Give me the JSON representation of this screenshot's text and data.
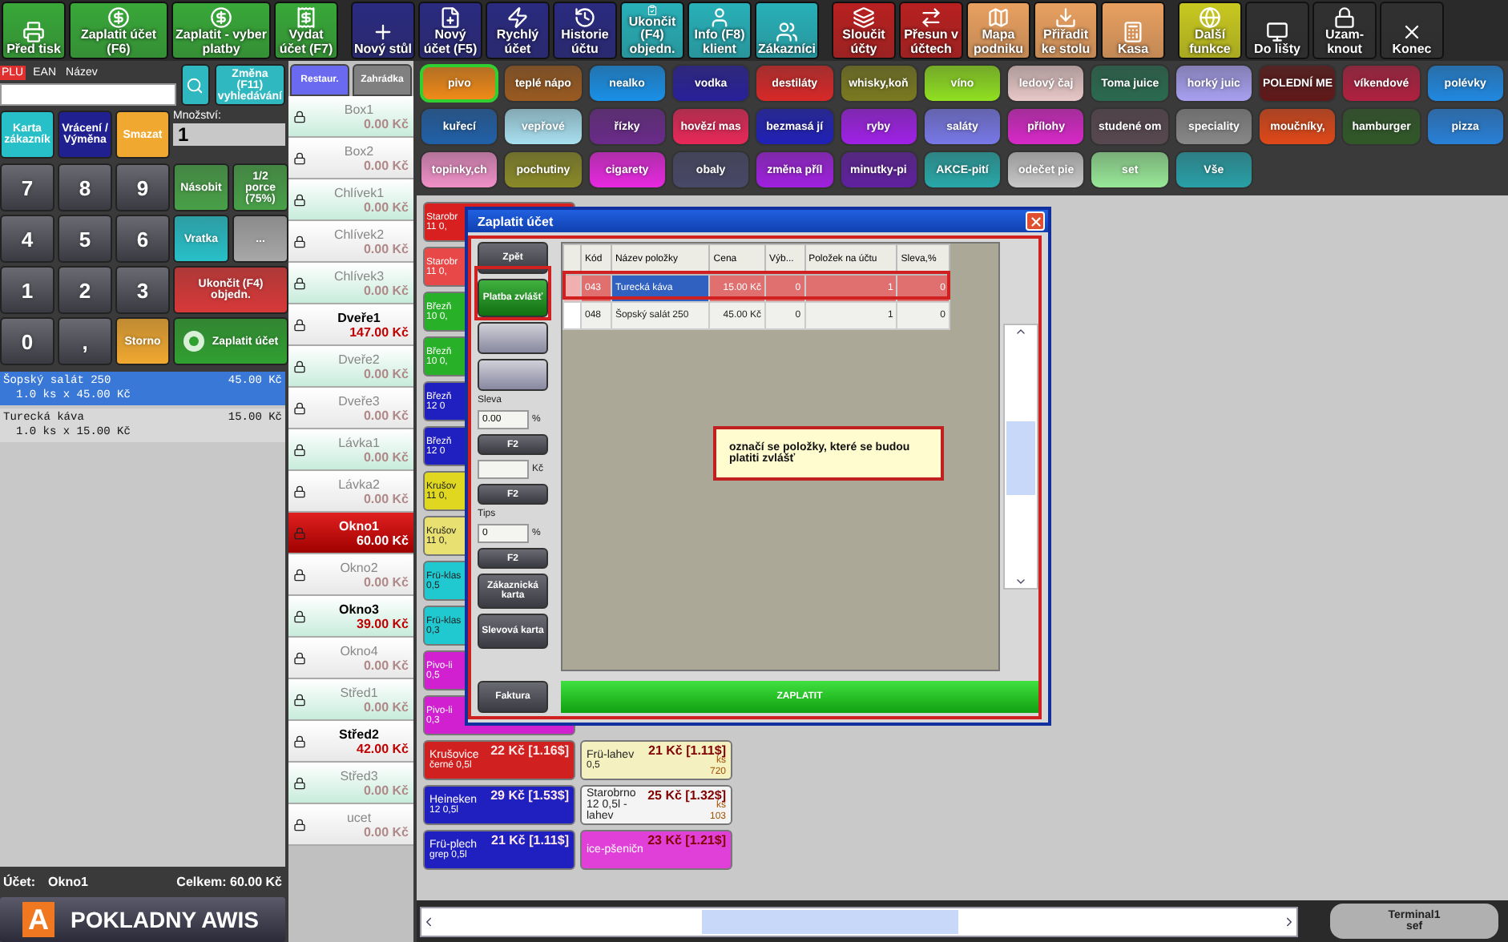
{
  "toolbar": [
    {
      "label": "Před tisk",
      "color": "#38a838",
      "kind": "normal"
    },
    {
      "label": "Zaplatit účet (F6)",
      "color": "#38a838",
      "kind": "wide"
    },
    {
      "label": "Zaplatit - vyber platby",
      "color": "#38a838",
      "kind": "wide"
    },
    {
      "label": "Vydat účet (F7)",
      "color": "#38a838",
      "kind": "normal"
    },
    {
      "label": "Nový stůl",
      "color": "#2a2a80",
      "kind": "normal"
    },
    {
      "label": "Nový účet (F5)",
      "color": "#2a2a80",
      "kind": "normal"
    },
    {
      "label": "Rychlý účet",
      "color": "#2a2a80",
      "kind": "normal"
    },
    {
      "label": "Historie účtu",
      "color": "#2a2a80",
      "kind": "normal"
    },
    {
      "label": "Ukončit (F4) objedn.",
      "color": "#28b0b8",
      "kind": "normal"
    },
    {
      "label": "Info (F8) klient",
      "color": "#28b0b8",
      "kind": "normal"
    },
    {
      "label": "Zákazníci",
      "color": "#28b0b8",
      "kind": "normal"
    },
    {
      "label": "Sloučit účty",
      "color": "#b82020",
      "kind": "normal"
    },
    {
      "label": "Přesun v účtech",
      "color": "#b82020",
      "kind": "normal"
    },
    {
      "label": "Mapa podniku",
      "color": "#e8a060",
      "kind": "normal"
    },
    {
      "label": "Přiřadit ke stolu",
      "color": "#e8a060",
      "kind": "normal"
    },
    {
      "label": "Kasa",
      "color": "#e8a060",
      "kind": "normal"
    },
    {
      "label": "Další funkce",
      "color": "#c8c820",
      "kind": "normal"
    },
    {
      "label": "Do lišty",
      "color": "#303030",
      "kind": "normal"
    },
    {
      "label": "Uzam-knout",
      "color": "#303030",
      "kind": "normal"
    },
    {
      "label": "Konec",
      "color": "#303030",
      "kind": "normal"
    }
  ],
  "search": {
    "modes": [
      {
        "label": "PLU",
        "selected": true
      },
      {
        "label": "EAN",
        "selected": false
      },
      {
        "label": "Název",
        "selected": false
      }
    ],
    "change_button": "Změna (F11) vyhledávání"
  },
  "quick_buttons": [
    {
      "label": "Karta zákazník",
      "color": "#28c0c8"
    },
    {
      "label": "Vrácení / Výměna",
      "color": "#202090"
    },
    {
      "label": "Smazat",
      "color": "#f0a830"
    }
  ],
  "quantity": {
    "label": "Množství:",
    "value": "1"
  },
  "keypad": [
    {
      "label": "7",
      "kind": "key"
    },
    {
      "label": "8",
      "kind": "key"
    },
    {
      "label": "9",
      "kind": "key"
    },
    {
      "label": "Násobit",
      "kind": "action",
      "color": "#48a048"
    },
    {
      "label": "1/2 porce (75%)",
      "kind": "action",
      "color": "#48a048"
    },
    {
      "label": "4",
      "kind": "key"
    },
    {
      "label": "5",
      "kind": "key"
    },
    {
      "label": "6",
      "kind": "key"
    },
    {
      "label": "Vratka",
      "kind": "action",
      "color": "#28c0c8"
    },
    {
      "label": "...",
      "kind": "action",
      "color": "#a8a8a8"
    },
    {
      "label": "1",
      "kind": "key"
    },
    {
      "label": "2",
      "kind": "key"
    },
    {
      "label": "3",
      "kind": "key"
    },
    {
      "label": "Ukončit (F4) objedn.",
      "kind": "wide",
      "color": "#d83838"
    },
    {
      "label": "0",
      "kind": "key"
    },
    {
      "label": ",",
      "kind": "key"
    },
    {
      "label": "Storno",
      "kind": "action",
      "color": "#f0a830"
    },
    {
      "label": "Zaplatit účet",
      "kind": "pay",
      "color": "#30a030"
    }
  ],
  "order": {
    "items": [
      {
        "name": "Šopský salát 250",
        "detail": "1.0 ks x 45.00 Kč",
        "price": "45.00 Kč",
        "selected": true
      },
      {
        "name": "Turecká káva",
        "detail": "1.0 ks x 15.00 Kč",
        "price": "15.00 Kč",
        "selected": false
      }
    ],
    "account_label": "Účet:",
    "account": "Okno1",
    "total": "Celkem: 60.00 Kč"
  },
  "logo": {
    "mark": "A",
    "text": "POKLADNY AWIS"
  },
  "areas": [
    {
      "label": "Restaur.",
      "selected": true
    },
    {
      "label": "Zahrádka",
      "selected": false
    }
  ],
  "tables": [
    {
      "name": "Box1",
      "amount": "0.00 Kč",
      "occupied": false,
      "selected": false
    },
    {
      "name": "Box2",
      "amount": "0.00 Kč",
      "occupied": false,
      "selected": false
    },
    {
      "name": "Chlívek1",
      "amount": "0.00 Kč",
      "occupied": false,
      "selected": false
    },
    {
      "name": "Chlívek2",
      "amount": "0.00 Kč",
      "occupied": false,
      "selected": false
    },
    {
      "name": "Chlívek3",
      "amount": "0.00 Kč",
      "occupied": false,
      "selected": false
    },
    {
      "name": "Dveře1",
      "amount": "147.00 Kč",
      "occupied": true,
      "selected": false
    },
    {
      "name": "Dveře2",
      "amount": "0.00 Kč",
      "occupied": false,
      "selected": false
    },
    {
      "name": "Dveře3",
      "amount": "0.00 Kč",
      "occupied": false,
      "selected": false
    },
    {
      "name": "Lávka1",
      "amount": "0.00 Kč",
      "occupied": false,
      "selected": false
    },
    {
      "name": "Lávka2",
      "amount": "0.00 Kč",
      "occupied": false,
      "selected": false
    },
    {
      "name": "Okno1",
      "amount": "60.00 Kč",
      "occupied": true,
      "selected": true
    },
    {
      "name": "Okno2",
      "amount": "0.00 Kč",
      "occupied": false,
      "selected": false
    },
    {
      "name": "Okno3",
      "amount": "39.00 Kč",
      "occupied": true,
      "selected": false
    },
    {
      "name": "Okno4",
      "amount": "0.00 Kč",
      "occupied": false,
      "selected": false
    },
    {
      "name": "Střed1",
      "amount": "0.00 Kč",
      "occupied": false,
      "selected": false
    },
    {
      "name": "Střed2",
      "amount": "42.00 Kč",
      "occupied": true,
      "selected": false
    },
    {
      "name": "Střed3",
      "amount": "0.00 Kč",
      "occupied": false,
      "selected": false
    },
    {
      "name": "ucet",
      "amount": "0.00 Kč",
      "occupied": false,
      "selected": false
    }
  ],
  "categories": [
    {
      "label": "pivo",
      "color": "#f08a18",
      "selected": true
    },
    {
      "label": "teplé nápo",
      "color": "#9a5a20",
      "selected": false
    },
    {
      "label": "nealko",
      "color": "#1890e8",
      "selected": false
    },
    {
      "label": "vodka",
      "color": "#28209a",
      "selected": false
    },
    {
      "label": "destiláty",
      "color": "#d82828",
      "selected": false
    },
    {
      "label": "whisky,koň",
      "color": "#7a7a20",
      "selected": false
    },
    {
      "label": "víno",
      "color": "#90e020",
      "selected": false
    },
    {
      "label": "ledový čaj",
      "color": "#e8c8c8",
      "selected": false
    },
    {
      "label": "Toma juice",
      "color": "#2a6a50",
      "selected": false
    },
    {
      "label": "horký juic",
      "color": "#a8a0f0",
      "selected": false
    },
    {
      "label": "POLEDNÍ ME",
      "color": "#601818",
      "selected": false
    },
    {
      "label": "víkendové",
      "color": "#b02040",
      "selected": false
    },
    {
      "label": "polévky",
      "color": "#2088e0",
      "selected": false
    },
    {
      "label": "kuřecí",
      "color": "#2060a8",
      "selected": false
    },
    {
      "label": "vepřové",
      "color": "#a8e0f0",
      "selected": false
    },
    {
      "label": "řízky",
      "color": "#6a2a8a",
      "selected": false
    },
    {
      "label": "hovězí mas",
      "color": "#e82858",
      "selected": false
    },
    {
      "label": "bezmasá jí",
      "color": "#2020b8",
      "selected": false
    },
    {
      "label": "ryby",
      "color": "#a020e8",
      "selected": false
    },
    {
      "label": "saláty",
      "color": "#7878e8",
      "selected": false
    },
    {
      "label": "přílohy",
      "color": "#d828c8",
      "selected": false
    },
    {
      "label": "studené om",
      "color": "#584850",
      "selected": false
    },
    {
      "label": "speciality",
      "color": "#888888",
      "selected": false
    },
    {
      "label": "moučníky,",
      "color": "#e04818",
      "selected": false
    },
    {
      "label": "hamburger",
      "color": "#305828",
      "selected": false
    },
    {
      "label": "pizza",
      "color": "#2880d8",
      "selected": false
    },
    {
      "label": "topinky,ch",
      "color": "#f090c8",
      "selected": false
    },
    {
      "label": "pochutiny",
      "color": "#8a8a28",
      "selected": false
    },
    {
      "label": "cigarety",
      "color": "#e828e0",
      "selected": false
    },
    {
      "label": "obaly",
      "color": "#484868",
      "selected": false
    },
    {
      "label": "změna příl",
      "color": "#a020e0",
      "selected": false
    },
    {
      "label": "minutky-pi",
      "color": "#6020a0",
      "selected": false
    },
    {
      "label": "AKCE-pití",
      "color": "#28a8a8",
      "selected": false
    },
    {
      "label": "odečet pie",
      "color": "#c8c8c8",
      "selected": false
    },
    {
      "label": "set",
      "color": "#98e898",
      "selected": false
    },
    {
      "label": "Vše",
      "color": "#28a0a8",
      "selected": false
    }
  ],
  "products": {
    "column_1": [
      {
        "name": "Starobr",
        "detail": "11 0,",
        "color": "#d82020"
      },
      {
        "name": "Starobr",
        "detail": "11 0,",
        "color": "#e84848"
      },
      {
        "name": "Březň",
        "detail": "10 0,",
        "color": "#28b028"
      },
      {
        "name": "Březň",
        "detail": "10 0,",
        "color": "#28b028"
      },
      {
        "name": "Březň",
        "detail": "12 0",
        "color": "#2020c0"
      },
      {
        "name": "Březň",
        "detail": "12 0",
        "color": "#2020c0"
      },
      {
        "name": "Krušov",
        "detail": "11 0,",
        "color": "#e0d820"
      },
      {
        "name": "Krušov",
        "detail": "11 0,",
        "color": "#e8e070"
      },
      {
        "name": "Frü-klas",
        "detail": "0,5",
        "color": "#20c8d0"
      },
      {
        "name": "Frü-klas",
        "detail": "0,3",
        "color": "#20c8d0"
      },
      {
        "name": "Pivo-li",
        "detail": "0,5",
        "color": "#d020d0"
      },
      {
        "name": "Pivo-li",
        "detail": "0,3",
        "color": "#d020d0"
      },
      {
        "name": "Krušovice",
        "detail": "černé 0,5l",
        "price": "22 Kč [1.16$]",
        "color": "#d02020"
      },
      {
        "name": "Heineken",
        "detail": "12 0,5l",
        "price": "29 Kč [1.53$]",
        "color": "#2020c0"
      },
      {
        "name": "Frü-plech",
        "detail": "grep 0,5l",
        "price": "21 Kč [1.11$]",
        "color": "#2020c0"
      }
    ],
    "column_2": [
      {
        "name": "Frü-lahev",
        "detail": "0,5",
        "price": "21 Kč [1.11$]",
        "unit": "ks",
        "stock": "720",
        "color": "#f4f0c0"
      },
      {
        "name": "Starobrno 12 0,5l - lahev",
        "price": "25 Kč [1.32$]",
        "unit": "ks",
        "stock": "103",
        "color": "#f4f4f4"
      },
      {
        "name": "ice-pšeničn",
        "price": "23 Kč [1.21$]",
        "color": "#e040d8"
      }
    ]
  },
  "dialog": {
    "title": "Zaplatit účet",
    "buttons": [
      {
        "label": "Zpět",
        "kind": "dark"
      },
      {
        "label": "Platba zvlášť",
        "kind": "green"
      },
      {
        "kind": "blank"
      },
      {
        "kind": "blank"
      }
    ],
    "discount": {
      "label": "Sleva",
      "value": "0.00",
      "unit": "%",
      "button": "F2"
    },
    "amount": {
      "unit": "Kč",
      "button": "F2"
    },
    "tips": {
      "label": "Tips",
      "value": "0",
      "unit": "%",
      "button": "F2"
    },
    "card_buttons": [
      "Zákaznická karta",
      "Slevová karta"
    ],
    "invoice_button": "Faktura",
    "columns": [
      "Kód",
      "Název položky",
      "Cena",
      "Výb...",
      "Položek na účtu",
      "Sleva,%"
    ],
    "rows": [
      {
        "cells": [
          "043",
          "Turecká káva",
          "15.00 Kč",
          "0",
          "1",
          "0"
        ],
        "selected": true
      },
      {
        "cells": [
          "048",
          "Šopský salát 250",
          "45.00 Kč",
          "0",
          "1",
          "0"
        ],
        "selected": false
      }
    ],
    "note": "označí se položky, které se budou platiti zvlášť",
    "pay_button": "ZAPLATIT"
  },
  "terminal": {
    "name": "Terminal1",
    "user": "sef"
  }
}
